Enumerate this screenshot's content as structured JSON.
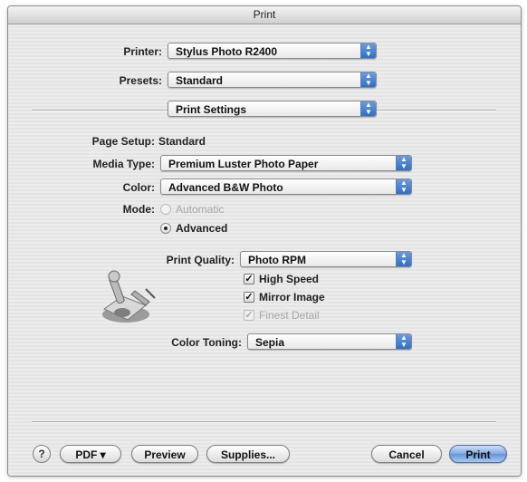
{
  "window": {
    "title": "Print"
  },
  "printer": {
    "label": "Printer:",
    "value": "Stylus Photo R2400"
  },
  "presets": {
    "label": "Presets:",
    "value": "Standard"
  },
  "panel": {
    "value": "Print Settings"
  },
  "page_setup": {
    "label": "Page Setup:",
    "value": "Standard"
  },
  "media_type": {
    "label": "Media Type:",
    "value": "Premium Luster Photo Paper"
  },
  "color": {
    "label": "Color:",
    "value": "Advanced B&W Photo"
  },
  "mode": {
    "label": "Mode:",
    "options": [
      {
        "label": "Automatic",
        "selected": false,
        "enabled": false
      },
      {
        "label": "Advanced",
        "selected": true,
        "enabled": true
      }
    ]
  },
  "print_quality": {
    "label": "Print Quality:",
    "value": "Photo RPM"
  },
  "checkboxes": [
    {
      "label": "High Speed",
      "checked": true,
      "enabled": true
    },
    {
      "label": "Mirror Image",
      "checked": true,
      "enabled": true
    },
    {
      "label": "Finest Detail",
      "checked": true,
      "enabled": false
    }
  ],
  "color_toning": {
    "label": "Color Toning:",
    "value": "Sepia"
  },
  "footer": {
    "help": "?",
    "pdf": "PDF ▾",
    "preview": "Preview",
    "supplies": "Supplies...",
    "cancel": "Cancel",
    "print": "Print"
  },
  "icons": {
    "popup_arrows": "up-down-arrows-icon",
    "printer_illustration": "printer-settings-icon",
    "help": "help-icon"
  },
  "colors": {
    "accent": "#3f7ed1",
    "window_bg": "#e9e9e9"
  }
}
